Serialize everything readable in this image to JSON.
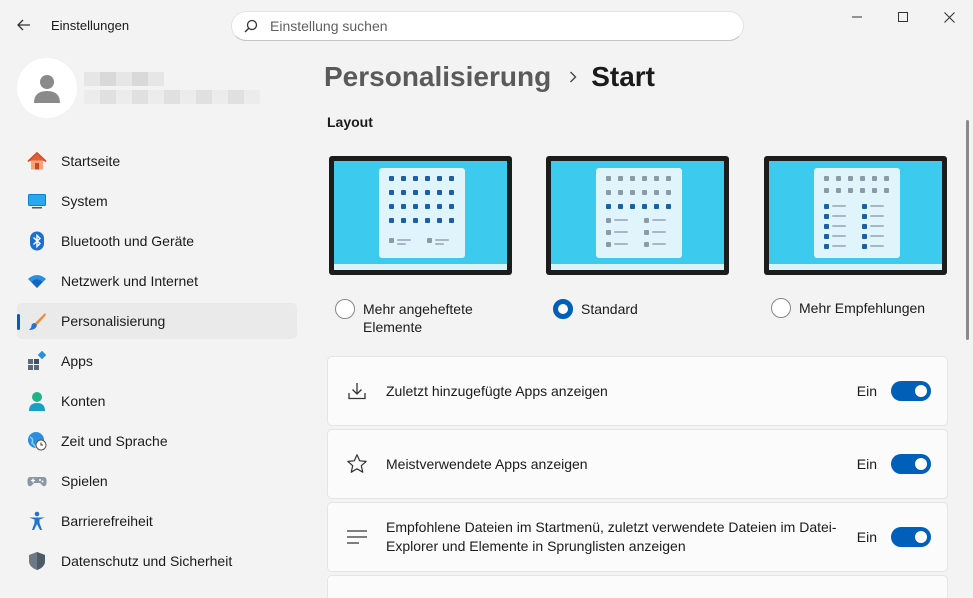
{
  "window": {
    "title": "Einstellungen"
  },
  "search": {
    "placeholder": "Einstellung suchen"
  },
  "nav": {
    "items": [
      {
        "label": "Startseite",
        "icon": "home-icon"
      },
      {
        "label": "System",
        "icon": "monitor-icon"
      },
      {
        "label": "Bluetooth und Geräte",
        "icon": "bluetooth-icon"
      },
      {
        "label": "Netzwerk und Internet",
        "icon": "wifi-icon"
      },
      {
        "label": "Personalisierung",
        "icon": "brush-icon",
        "active": true
      },
      {
        "label": "Apps",
        "icon": "apps-icon"
      },
      {
        "label": "Konten",
        "icon": "account-icon"
      },
      {
        "label": "Zeit und Sprache",
        "icon": "globe-clock-icon"
      },
      {
        "label": "Spielen",
        "icon": "gamepad-icon"
      },
      {
        "label": "Barrierefreiheit",
        "icon": "accessibility-icon"
      },
      {
        "label": "Datenschutz und Sicherheit",
        "icon": "shield-icon"
      }
    ]
  },
  "breadcrumb": {
    "parent": "Personalisierung",
    "current": "Start"
  },
  "layout": {
    "title": "Layout",
    "options": [
      {
        "label": "Mehr angeheftete Elemente",
        "line1": "Mehr angeheftete",
        "line2": "Elemente",
        "checked": false
      },
      {
        "label": "Standard",
        "checked": true
      },
      {
        "label": "Mehr Empfehlungen",
        "checked": false
      }
    ]
  },
  "settings": [
    {
      "label": "Zuletzt hinzugefügte Apps anzeigen",
      "state": "Ein",
      "on": true,
      "icon": "download-icon"
    },
    {
      "label": "Meistverwendete Apps anzeigen",
      "state": "Ein",
      "on": true,
      "icon": "star-icon"
    },
    {
      "label": "Empfohlene Dateien im Startmenü, zuletzt verwendete Dateien im Datei-Explorer und Elemente in Sprunglisten anzeigen",
      "line1": "Empfohlene Dateien im Startmenü, zuletzt verwendete Dateien im Datei-",
      "line2": "Explorer und Elemente in Sprunglisten anzeigen",
      "state": "Ein",
      "on": true,
      "icon": "list-icon"
    }
  ],
  "colors": {
    "accent": "#005fb8",
    "tile_blue": "#1a5fa8",
    "tile_gray": "#8a9aa6",
    "screen": "#3ccbef"
  }
}
